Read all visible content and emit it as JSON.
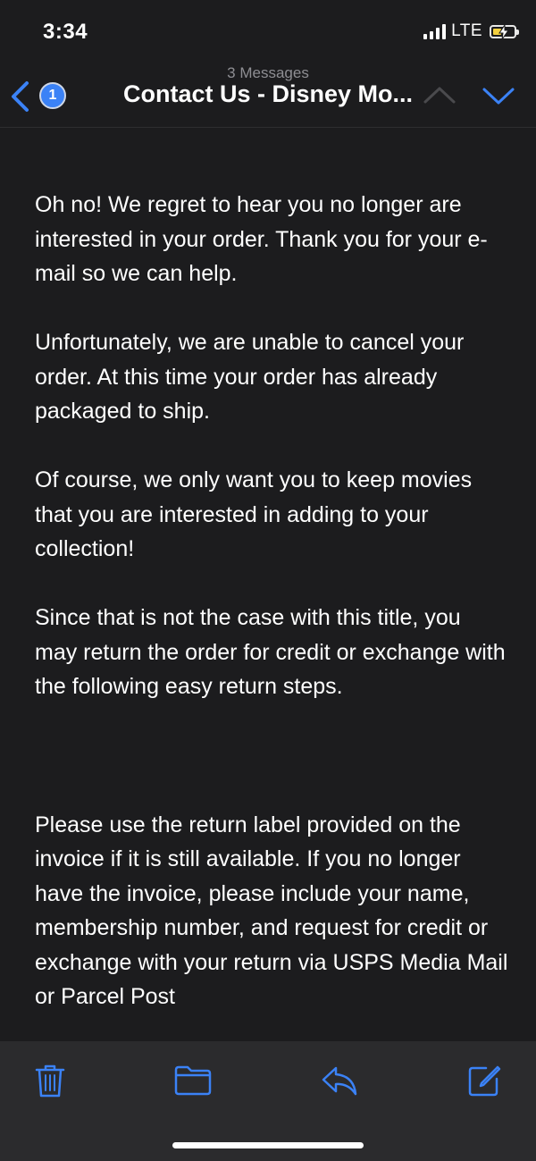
{
  "status_bar": {
    "time": "3:34",
    "network": "LTE"
  },
  "header": {
    "back_badge": "1",
    "subtitle": "3 Messages",
    "title": "Contact Us - Disney Mo..."
  },
  "message": {
    "paragraphs": [
      "Oh no! We regret to hear you no longer are interested in your order. Thank you for your e-mail so we can help.",
      "Unfortunately, we are unable to cancel your order. At this time your order has already packaged to ship.",
      "Of course, we only want you to keep movies that you are interested in adding to your collection!",
      "Since that is not the case with this title, you may return the order for credit or exchange with the following easy return steps.",
      "Please use the return label provided on the invoice if it is still available. If you no longer have the invoice, please include your name, membership number, and request for credit or exchange with your return via USPS Media Mail or Parcel Post"
    ]
  },
  "toolbar": {
    "icons": [
      "trash-icon",
      "folder-icon",
      "reply-icon",
      "compose-icon"
    ]
  },
  "colors": {
    "background": "#1c1c1e",
    "toolbar": "#2b2b2d",
    "accent": "#3b82f6",
    "text": "#ffffff",
    "muted": "#8e8e93"
  }
}
